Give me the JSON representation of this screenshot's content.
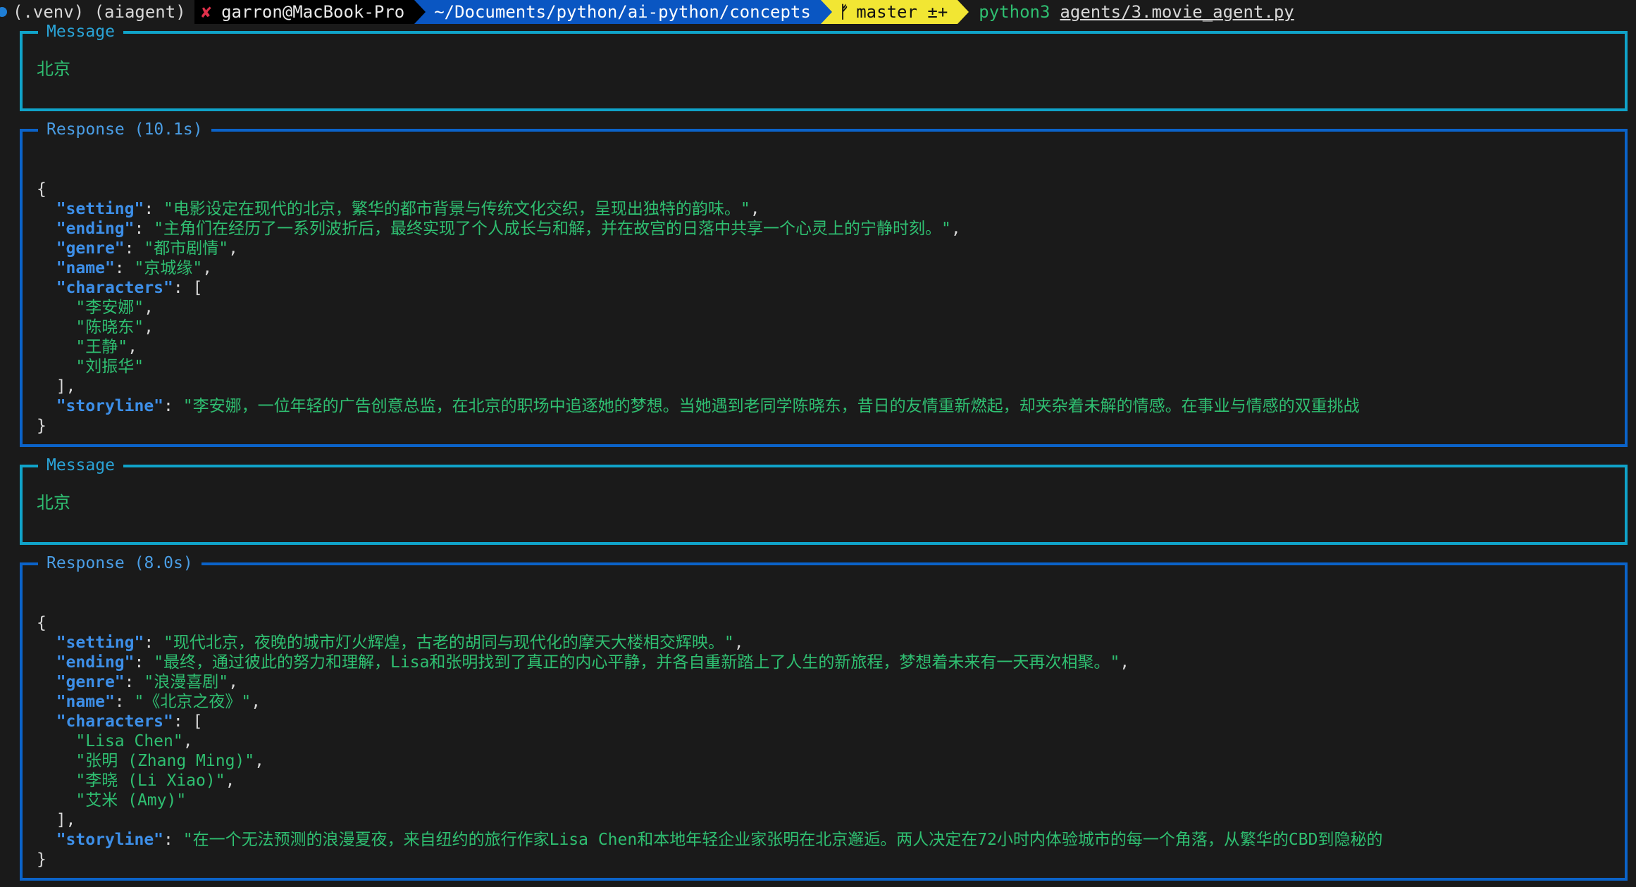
{
  "prompt": {
    "venv": "(.venv) (aiagent)",
    "status_icon": "✘",
    "user_host": "garron@MacBook-Pro",
    "path": "~/Documents/python/ai-python/concepts",
    "branch_icon": "ᚠ",
    "branch": "master ±+",
    "command": "python3",
    "script": "agents/3.movie_agent.py"
  },
  "panels": [
    {
      "title": "Message",
      "text": "北京"
    },
    {
      "title": "Response (10.1s)",
      "setting": "电影设定在现代的北京，繁华的都市背景与传统文化交织，呈现出独特的韵味。",
      "ending": "主角们在经历了一系列波折后，最终实现了个人成长与和解，并在故宫的日落中共享一个心灵上的宁静时刻。",
      "genre": "都市剧情",
      "name": "京城缘",
      "characters": [
        "李安娜",
        "陈晓东",
        "王静",
        "刘振华"
      ],
      "storyline": "李安娜，一位年轻的广告创意总监，在北京的职场中追逐她的梦想。当她遇到老同学陈晓东，昔日的友情重新燃起，却夹杂着未解的情感。在事业与情感的双重挑战"
    },
    {
      "title": "Message",
      "text": "北京"
    },
    {
      "title": "Response (8.0s)",
      "setting": "现代北京，夜晚的城市灯火辉煌，古老的胡同与现代化的摩天大楼相交辉映。",
      "ending": "最终，通过彼此的努力和理解，Lisa和张明找到了真正的内心平静，并各自重新踏上了人生的新旅程，梦想着未来有一天再次相聚。",
      "genre": "浪漫喜剧",
      "name": "《北京之夜》",
      "characters": [
        "Lisa Chen",
        "张明 (Zhang Ming)",
        "李晓 (Li Xiao)",
        "艾米 (Amy)"
      ],
      "storyline": "在一个无法预测的浪漫夏夜，来自纽约的旅行作家Lisa Chen和本地年轻企业家张明在北京邂逅。两人决定在72小时内体验城市的每一个角落，从繁华的CBD到隐秘的"
    }
  ],
  "colors": {
    "message_border": "#10a3c9",
    "response_border": "#0b63c9",
    "json_key": "#3d8fe8",
    "json_string": "#2fbf71"
  }
}
